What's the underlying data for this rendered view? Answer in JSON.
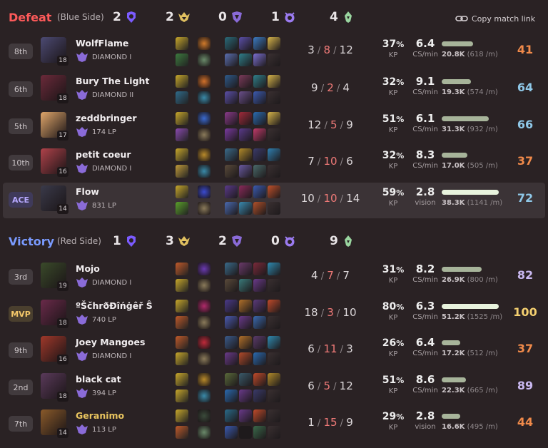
{
  "teams": [
    {
      "result": "Defeat",
      "side": "(Blue Side)",
      "result_color": "#ff5a5a",
      "objectives": {
        "towers": "2",
        "dragons": "2",
        "barons": "0",
        "heralds": "1",
        "grubs": "4"
      },
      "players": [
        {
          "rank": "8th",
          "rank_type": "normal",
          "name": "WolfFlame",
          "level": "18",
          "division": "DIAMOND I",
          "kda": {
            "k": "3",
            "d": "8",
            "a": "12"
          },
          "kp": "37",
          "cs": "6.4",
          "cs_label": "CS/min",
          "damage": "20.8K",
          "dpm": "(618 /m)",
          "damage_share": 0.55,
          "score": "41",
          "score_color": "#f08a4a",
          "champ_color": "#4c4a73",
          "spell_colors": [
            "#c7a72b",
            "#3c7a3e"
          ],
          "rune_colors": [
            "#d07a2a",
            "#6a8a6a"
          ],
          "item_colors": [
            "#2a6b7a",
            "#5b4fa8",
            "#3b7bc2",
            "#d7b54a",
            "#5b6fb0",
            "#2f7f8a",
            "#7b6fd0",
            "#3a3031"
          ]
        },
        {
          "rank": "6th",
          "rank_type": "normal",
          "name": "Bury The Light",
          "level": "18",
          "division": "DIAMOND II",
          "kda": {
            "k": "9",
            "d": "2",
            "a": "4"
          },
          "kp": "32",
          "cs": "9.1",
          "cs_label": "CS/min",
          "damage": "19.3K",
          "dpm": "(574 /m)",
          "damage_share": 0.51,
          "score": "64",
          "score_color": "#8fc8e8",
          "champ_color": "#6b2a3a",
          "spell_colors": [
            "#c7a72b",
            "#2f6b8a"
          ],
          "rune_colors": [
            "#d0702a",
            "#3a8aa8"
          ],
          "item_colors": [
            "#2e5a8a",
            "#7a3a5a",
            "#2f7f8a",
            "#d7b54a",
            "#5b4fa8",
            "#6a4f8a",
            "#3b5ab0",
            "#3a3031"
          ]
        },
        {
          "rank": "5th",
          "rank_type": "normal",
          "name": "zeddbringer",
          "level": "17",
          "division": "174 LP",
          "kda": {
            "k": "12",
            "d": "5",
            "a": "9"
          },
          "kp": "51",
          "cs": "6.1",
          "cs_label": "CS/min",
          "damage": "31.3K",
          "dpm": "(932 /m)",
          "damage_share": 0.82,
          "score": "66",
          "score_color": "#8fc8e8",
          "champ_color": "#e0a66a",
          "spell_colors": [
            "#c7a72b",
            "#8a4ab0"
          ],
          "rune_colors": [
            "#3a6ad0",
            "#8a7a5a"
          ],
          "item_colors": [
            "#8a3a8a",
            "#a02a3a",
            "#2a6bb0",
            "#d7b54a",
            "#7a3aa0",
            "#5a3a8a",
            "#c03a6a",
            "#3a3031"
          ]
        },
        {
          "rank": "10th",
          "rank_type": "normal",
          "name": "petit coeur",
          "level": "16",
          "division": "DIAMOND I",
          "kda": {
            "k": "7",
            "d": "10",
            "a": "6"
          },
          "kp": "32",
          "cs": "8.3",
          "cs_label": "CS/min",
          "damage": "17.0K",
          "dpm": "(505 /m)",
          "damage_share": 0.45,
          "score": "37",
          "score_color": "#f08a4a",
          "champ_color": "#b0424a",
          "spell_colors": [
            "#c7a72b",
            "#c09a3a"
          ],
          "rune_colors": [
            "#b88a2a",
            "#3a8aa8"
          ],
          "item_colors": [
            "#3a6b8a",
            "#b08a2a",
            "#3a3a6a",
            "#2f7fb0",
            "#5a4a3a",
            "#6a5aa0",
            "#4a6a6a",
            "#3a3031"
          ]
        },
        {
          "rank": "ACE",
          "rank_type": "ace",
          "name": "Flow",
          "level": "14",
          "division": "831 LP",
          "kda": {
            "k": "10",
            "d": "10",
            "a": "14"
          },
          "kp": "59",
          "cs": "2.8",
          "cs_label": "vision",
          "damage": "38.3K",
          "dpm": "(1141 /m)",
          "damage_share": 1.0,
          "score": "72",
          "score_color": "#8fc8e8",
          "champ_color": "#3a3a4a",
          "spell_colors": [
            "#c7a72b",
            "#5aa02a"
          ],
          "rune_colors": [
            "#3a4ad0",
            "#8a7a5a"
          ],
          "item_colors": [
            "#5a3a8a",
            "#8a2a5a",
            "#3a5ab0",
            "#c0502a",
            "#4a6ab0",
            "#3a8ab0",
            "#b0502a",
            "#3a3031"
          ]
        }
      ]
    },
    {
      "result": "Victory",
      "side": "(Red Side)",
      "result_color": "#7a9bff",
      "objectives": {
        "towers": "1",
        "dragons": "3",
        "barons": "2",
        "heralds": "0",
        "grubs": "9"
      },
      "players": [
        {
          "rank": "3rd",
          "rank_type": "normal",
          "name": "Mojo",
          "level": "19",
          "division": "DIAMOND I",
          "kda": {
            "k": "4",
            "d": "7",
            "a": "7"
          },
          "kp": "31",
          "cs": "8.2",
          "cs_label": "CS/min",
          "damage": "26.9K",
          "dpm": "(800 /m)",
          "damage_share": 0.7,
          "score": "82",
          "score_color": "#c9b8f0",
          "champ_color": "#3a4a2a",
          "spell_colors": [
            "#c05a2a",
            "#c7a72b"
          ],
          "rune_colors": [
            "#6a3ab0",
            "#8a7a5a"
          ],
          "item_colors": [
            "#3a6b8a",
            "#6a3a6a",
            "#7a2a3a",
            "#2f8ab0",
            "#5a4a3a",
            "#3a7a7a",
            "#6a3a8a",
            "#3a3031"
          ]
        },
        {
          "rank": "MVP",
          "rank_type": "mvp",
          "name": "ºŠčhrðĐîńġêř Ŝ",
          "level": "18",
          "division": "740 LP",
          "kda": {
            "k": "18",
            "d": "3",
            "a": "10"
          },
          "kp": "80",
          "cs": "6.3",
          "cs_label": "CS/min",
          "damage": "51.2K",
          "dpm": "(1525 /m)",
          "damage_share": 1.0,
          "score": "100",
          "score_color": "#f4d070",
          "champ_color": "#6a2a4a",
          "spell_colors": [
            "#c7a72b",
            "#c05a2a"
          ],
          "rune_colors": [
            "#b02a6a",
            "#8a7a5a"
          ],
          "item_colors": [
            "#4a3a8a",
            "#b0702a",
            "#5a3a7a",
            "#c04a2a",
            "#4a5ab0",
            "#6a3a8a",
            "#3a6ab0",
            "#3a3031"
          ]
        },
        {
          "rank": "9th",
          "rank_type": "normal",
          "name": "Joey Mangoes",
          "level": "16",
          "division": "DIAMOND I",
          "kda": {
            "k": "6",
            "d": "11",
            "a": "3"
          },
          "kp": "26",
          "cs": "6.4",
          "cs_label": "CS/min",
          "damage": "17.2K",
          "dpm": "(512 /m)",
          "damage_share": 0.33,
          "score": "37",
          "score_color": "#f08a4a",
          "champ_color": "#a0382a",
          "spell_colors": [
            "#c05a2a",
            "#c7a72b"
          ],
          "rune_colors": [
            "#c02a3a",
            "#8a7a5a"
          ],
          "item_colors": [
            "#3a5a8a",
            "#b0702a",
            "#5a3a6a",
            "#2f8ab0",
            "#6a3a8a",
            "#b04a2a",
            "#2a6ab0",
            "#3a3031"
          ]
        },
        {
          "rank": "2nd",
          "rank_type": "normal",
          "name": "black cat",
          "level": "18",
          "division": "394 LP",
          "kda": {
            "k": "6",
            "d": "5",
            "a": "12"
          },
          "kp": "51",
          "cs": "8.6",
          "cs_label": "CS/min",
          "damage": "22.3K",
          "dpm": "(665 /m)",
          "damage_share": 0.43,
          "score": "89",
          "score_color": "#c9b8f0",
          "champ_color": "#5a3a5a",
          "spell_colors": [
            "#c7a72b",
            "#c7a72b"
          ],
          "rune_colors": [
            "#b88a2a",
            "#3a8aa8"
          ],
          "item_colors": [
            "#5a6a3a",
            "#3a5a6a",
            "#c04a2a",
            "#b08a2a",
            "#2a6ab0",
            "#6a3a8a",
            "#3a3a6a",
            "#3a3031"
          ]
        },
        {
          "rank": "7th",
          "rank_type": "normal",
          "name": "Geranimo",
          "name_gold": true,
          "level": "14",
          "division": "113 LP",
          "kda": {
            "k": "1",
            "d": "15",
            "a": "9"
          },
          "kp": "29",
          "cs": "2.8",
          "cs_label": "vision",
          "damage": "16.6K",
          "dpm": "(495 /m)",
          "damage_share": 0.33,
          "score": "44",
          "score_color": "#f08a4a",
          "champ_color": "#8a5a2a",
          "spell_colors": [
            "#c7a72b",
            "#c05a2a"
          ],
          "rune_colors": [
            "#3a4a3a",
            "#6a8a6a"
          ],
          "item_colors": [
            "#2a6b8a",
            "#6a3a8a",
            "#c04a2a",
            "#3a3031",
            "#3a5ab0",
            "#1e1a1c",
            "#3a6a4a",
            "#3a3031"
          ]
        }
      ]
    }
  ],
  "copy_link": "Copy match link",
  "labels": {
    "kp": "KP",
    "percent": "%"
  },
  "icons": {
    "tower": "tower-icon",
    "dragon": "dragon-icon",
    "baron": "baron-icon",
    "herald": "herald-icon",
    "grub": "grub-icon",
    "link": "link-icon",
    "rank_emblem": "rank-emblem-icon"
  }
}
